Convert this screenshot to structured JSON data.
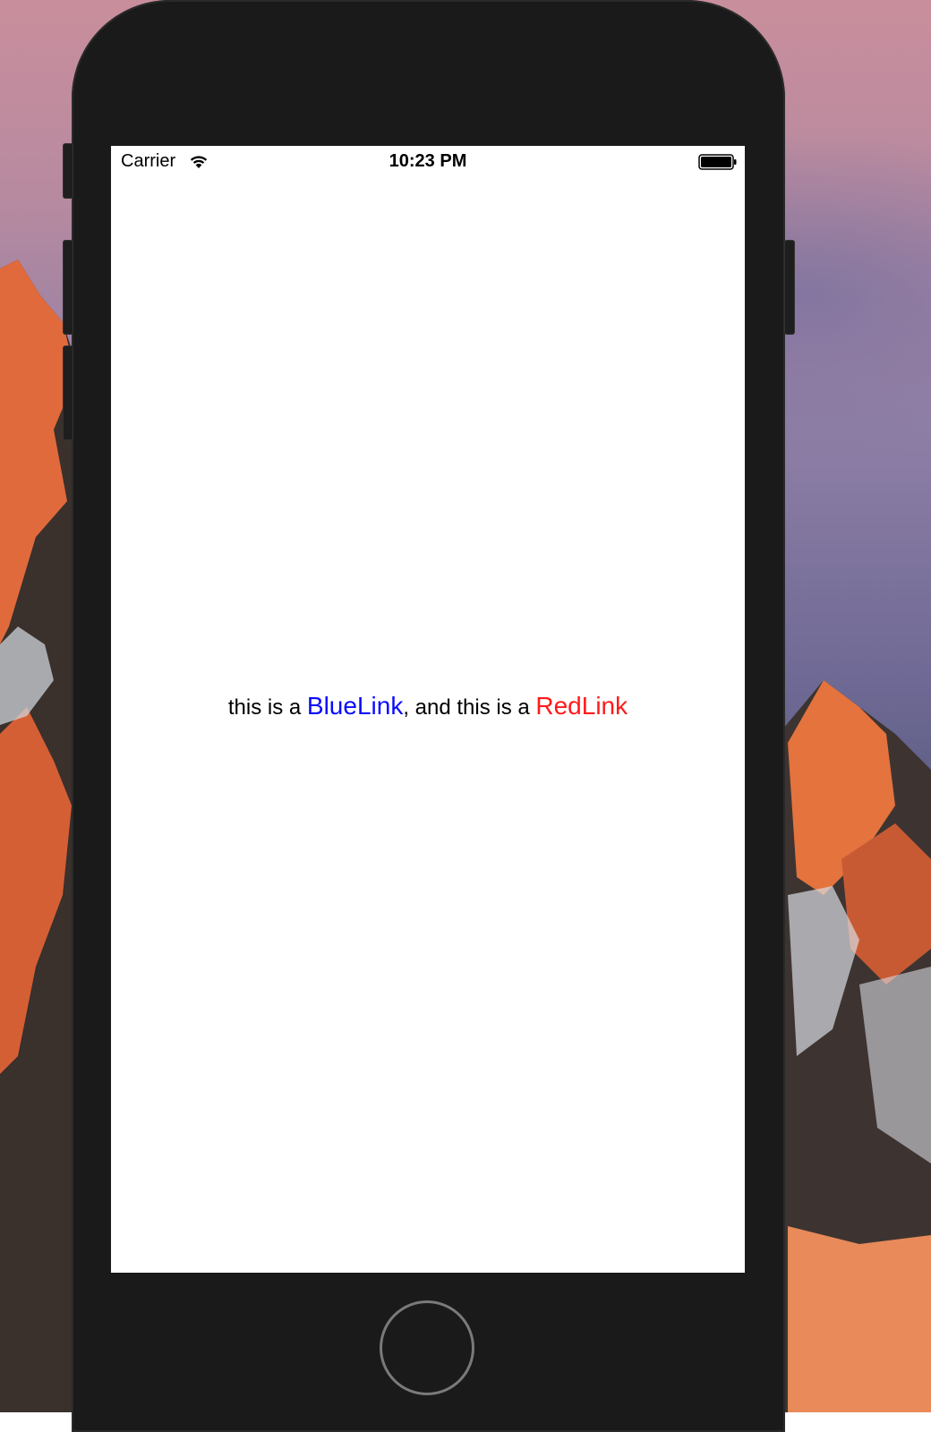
{
  "status_bar": {
    "carrier": "Carrier",
    "time": "10:23 PM",
    "wifi_icon": "wifi-icon",
    "battery_icon": "battery-icon",
    "battery_level": 1.0
  },
  "content": {
    "prefix": "this is a ",
    "blue_link": "BlueLink",
    "middle": ", and this is a ",
    "red_link": "RedLink"
  },
  "colors": {
    "blue_link": "#0a0aff",
    "red_link": "#ff1a1a",
    "device_frame": "#1a1a1a",
    "screen_background": "#ffffff"
  },
  "icons": {
    "home_button": "home-button-icon"
  }
}
